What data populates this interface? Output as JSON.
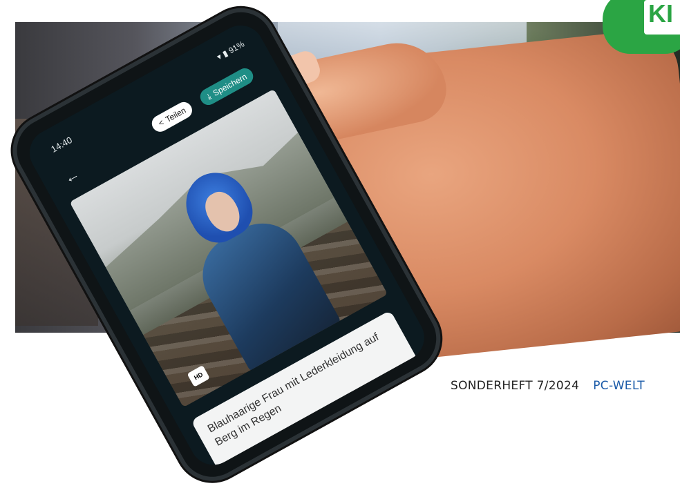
{
  "phone": {
    "status_time": "14:40",
    "status_battery": "91%",
    "share_label": "Teilen",
    "save_label": "Speichern",
    "hd_badge": "HD",
    "prompt_text": "Blauhaarige Frau mit Lederkleidung auf Berg im Regen"
  },
  "logo": {
    "text": "KI",
    "color": "#2ba544"
  },
  "footer": {
    "issue": "SONDERHEFT 7/2024",
    "brand": "PC-WELT",
    "brand_color": "#1a5aa8"
  },
  "icons": [
    "back-arrow-icon",
    "share-icon",
    "download-icon",
    "wifi-icon",
    "battery-icon"
  ]
}
